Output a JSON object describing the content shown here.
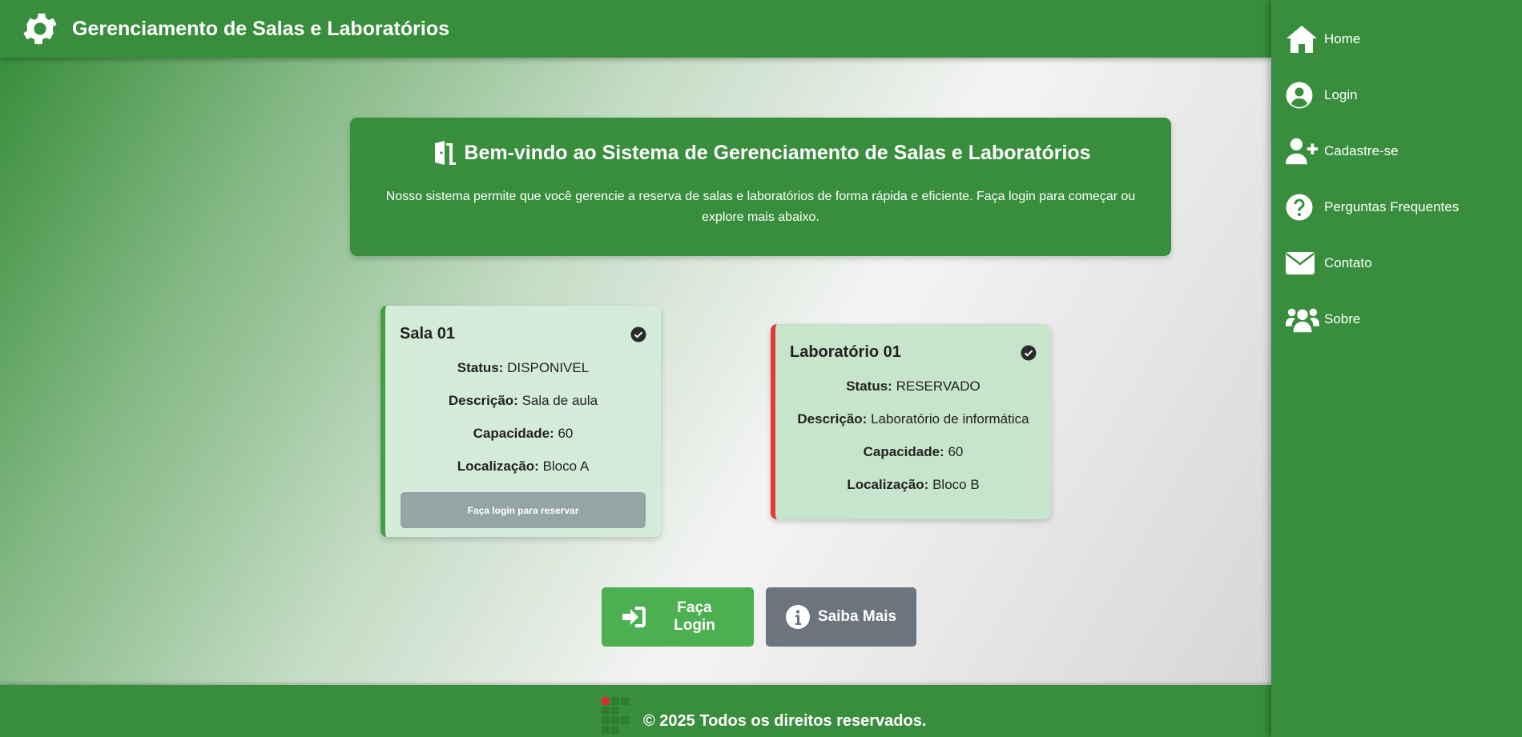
{
  "header": {
    "title": "Gerenciamento de Salas e Laboratórios"
  },
  "welcome": {
    "title": "Bem-vindo ao Sistema de Gerenciamento de Salas e Laboratórios",
    "text": "Nosso sistema permite que você gerencie a reserva de salas e laboratórios de forma rápida e eficiente. Faça login para começar ou explore mais abaixo."
  },
  "rooms": [
    {
      "name": "Sala 01",
      "status_label": "Status:",
      "status": "DISPONIVEL",
      "description_label": "Descrição:",
      "description": "Sala de aula",
      "capacity_label": "Capacidade:",
      "capacity": "60",
      "location_label": "Localização:",
      "location": "Bloco A",
      "reserve_label": "Faça login para reservar",
      "accent": "#43a047"
    },
    {
      "name": "Laboratório 01",
      "status_label": "Status:",
      "status": "RESERVADO",
      "description_label": "Descrição:",
      "description": "Laboratório de informática",
      "capacity_label": "Capacidade:",
      "capacity": "60",
      "location_label": "Localização:",
      "location": "Bloco B",
      "accent": "#e53935"
    }
  ],
  "actions": {
    "login_label": "Faça Login",
    "more_label": "Saiba Mais"
  },
  "footer": {
    "copyright": "© 2025 Todos os direitos reservados."
  },
  "sidebar": {
    "items": [
      {
        "label": "Home",
        "icon": "home-icon"
      },
      {
        "label": "Login",
        "icon": "user-circle-icon"
      },
      {
        "label": "Cadastre-se",
        "icon": "user-plus-icon"
      },
      {
        "label": "Perguntas Frequentes",
        "icon": "question-circle-icon"
      },
      {
        "label": "Contato",
        "icon": "envelope-icon"
      },
      {
        "label": "Sobre",
        "icon": "users-icon"
      }
    ]
  },
  "colors": {
    "primary": "#388e3c",
    "success": "#4caf50",
    "secondary": "#6c757d",
    "disabled": "#95a5a6",
    "danger": "#e53935"
  }
}
